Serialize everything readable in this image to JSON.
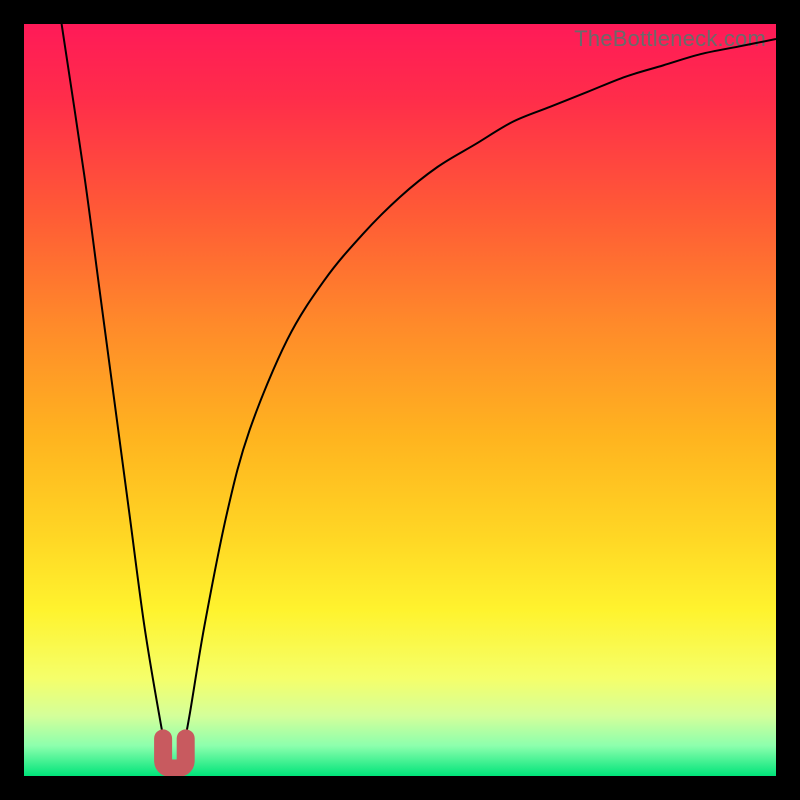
{
  "watermark": "TheBottleneck.com",
  "colors": {
    "frame": "#000000",
    "curve": "#000000",
    "dip_marker": "#c85a5f",
    "gradient_stops": [
      {
        "offset": 0.0,
        "color": "#ff1a58"
      },
      {
        "offset": 0.1,
        "color": "#ff2d4a"
      },
      {
        "offset": 0.25,
        "color": "#ff5a36"
      },
      {
        "offset": 0.4,
        "color": "#ff8a2a"
      },
      {
        "offset": 0.55,
        "color": "#ffb41f"
      },
      {
        "offset": 0.68,
        "color": "#ffd624"
      },
      {
        "offset": 0.78,
        "color": "#fff32e"
      },
      {
        "offset": 0.87,
        "color": "#f5ff6a"
      },
      {
        "offset": 0.92,
        "color": "#d4ff9a"
      },
      {
        "offset": 0.96,
        "color": "#8cffad"
      },
      {
        "offset": 1.0,
        "color": "#00e47a"
      }
    ]
  },
  "chart_data": {
    "type": "line",
    "title": "",
    "xlabel": "",
    "ylabel": "",
    "xlim": [
      0,
      100
    ],
    "ylim": [
      0,
      100
    ],
    "grid": false,
    "legend": false,
    "series": [
      {
        "name": "bottleneck-curve",
        "x": [
          5,
          8,
          10,
          12,
          14,
          16,
          18,
          19,
          20,
          21,
          22,
          24,
          27,
          30,
          35,
          40,
          45,
          50,
          55,
          60,
          65,
          70,
          75,
          80,
          85,
          90,
          95,
          100
        ],
        "values": [
          100,
          80,
          65,
          50,
          35,
          20,
          8,
          3,
          1,
          3,
          8,
          20,
          35,
          46,
          58,
          66,
          72,
          77,
          81,
          84,
          87,
          89,
          91,
          93,
          94.5,
          96,
          97,
          98
        ]
      }
    ],
    "annotations": [
      {
        "kind": "dip-marker",
        "x": 20,
        "y": 2,
        "width": 3,
        "note": "U-shaped minimum marker"
      }
    ],
    "background_gradient": "vertical red→orange→yellow→green"
  }
}
